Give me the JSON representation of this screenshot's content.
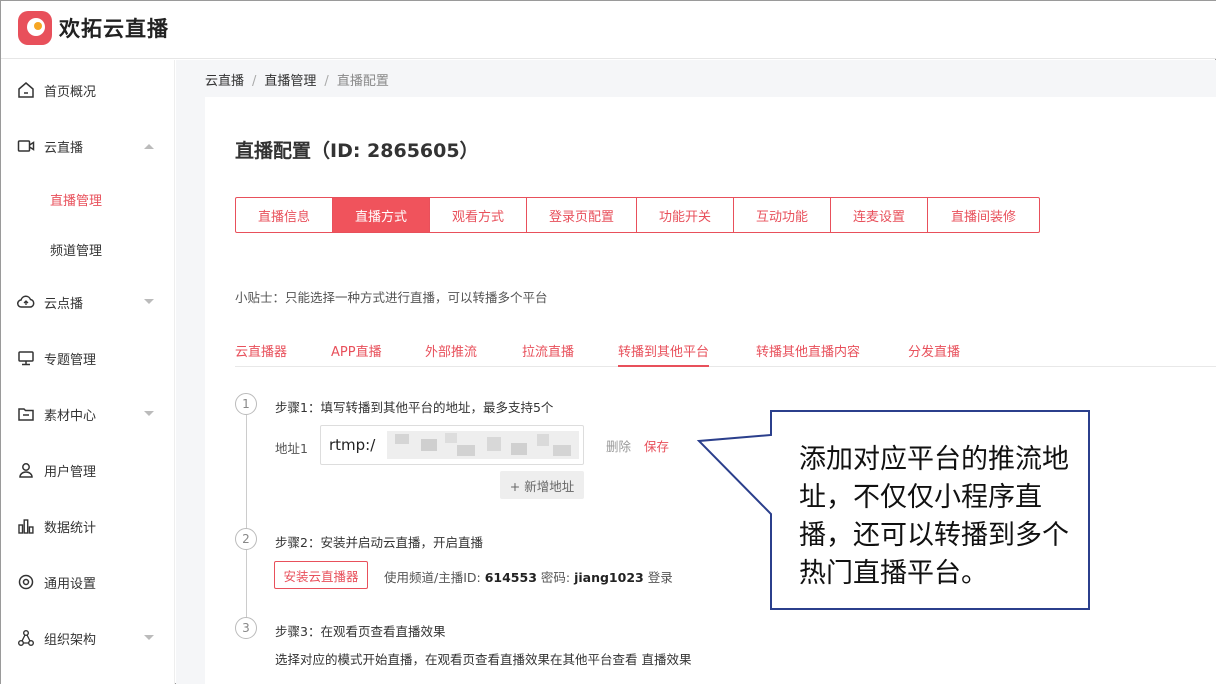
{
  "app": {
    "brand": "欢拓云直播"
  },
  "sidebar": {
    "items": [
      {
        "label": "首页概况",
        "icon": "home-icon"
      },
      {
        "label": "云直播",
        "icon": "video-icon"
      },
      {
        "label": "云点播",
        "icon": "cloud-icon"
      },
      {
        "label": "专题管理",
        "icon": "monitor-icon"
      },
      {
        "label": "素材中心",
        "icon": "folder-icon"
      },
      {
        "label": "用户管理",
        "icon": "user-icon"
      },
      {
        "label": "数据统计",
        "icon": "bar-chart-icon"
      },
      {
        "label": "通用设置",
        "icon": "settings-icon"
      },
      {
        "label": "组织架构",
        "icon": "org-icon"
      }
    ],
    "sub": [
      {
        "label": "直播管理"
      },
      {
        "label": "频道管理"
      }
    ]
  },
  "breadcrumb": [
    "云直播",
    "直播管理",
    "直播配置"
  ],
  "page": {
    "title": "直播配置（ID: 2865605）"
  },
  "tabs": [
    "直播信息",
    "直播方式",
    "观看方式",
    "登录页配置",
    "功能开关",
    "互动功能",
    "连麦设置",
    "直播间装修"
  ],
  "tip": "小贴士：只能选择一种方式进行直播，可以转播多个平台",
  "subtabs": [
    "云直播器",
    "APP直播",
    "外部推流",
    "拉流直播",
    "转播到其他平台",
    "转播其他直播内容",
    "分发直播"
  ],
  "steps": [
    {
      "num": "1",
      "text": "步骤1：填写转播到其他平台的地址，最多支持5个"
    },
    {
      "num": "2",
      "text": "步骤2：安装并启动云直播，开启直播"
    },
    {
      "num": "3",
      "text": "步骤3：在观看页查看直播效果"
    }
  ],
  "step1": {
    "addr_label": "地址1",
    "addr_value": "rtmp:/",
    "delete": "删除",
    "save": "保存",
    "add": "+ 新增地址"
  },
  "step2": {
    "install": "安装云直播器",
    "info_prefix": "使用频道/主播ID: ",
    "channel_id": "614553",
    "pwd_prefix": " 密码: ",
    "pwd": "jiang1023",
    "login": " 登录"
  },
  "step3": {
    "desc": "选择对应的模式开始直播，在观看页查看直播效果在其他平台查看 直播效果"
  },
  "callout": {
    "text": "添加对应平台的推流地址，不仅仅小程序直播，还可以转播到多个热门直播平台。"
  },
  "colors": {
    "accent": "#e8505b",
    "callout_border": "#2b3f8c"
  }
}
